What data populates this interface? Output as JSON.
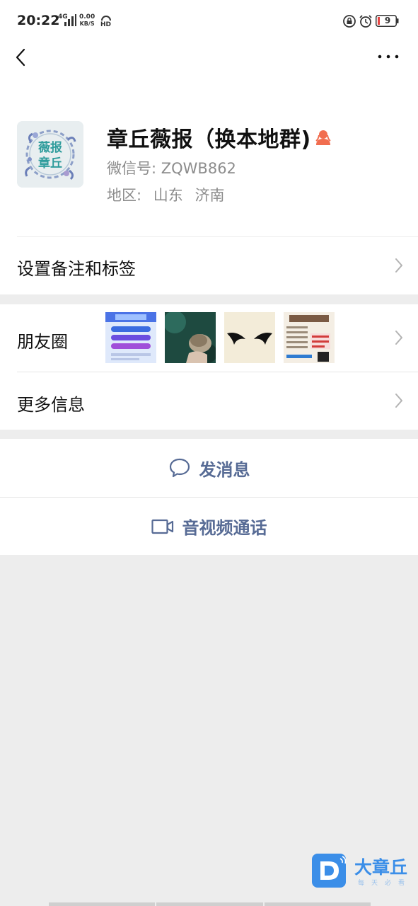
{
  "status_bar": {
    "time": "20:22",
    "network": "4G",
    "speed_value": "0.00",
    "speed_unit": "KB/S",
    "hd": "HD",
    "battery": "9"
  },
  "profile": {
    "name": "章丘薇报（换本地群)",
    "wechat_id": "微信号:  ZQWB862",
    "region_label": "地区:",
    "region_province": "山东",
    "region_city": "济南",
    "avatar_text_top": "薇报",
    "avatar_text_bottom": "章丘"
  },
  "rows": {
    "remark": "设置备注和标签",
    "moments": "朋友圈",
    "more_info": "更多信息"
  },
  "actions": {
    "message": "发消息",
    "call": "音视频通话"
  },
  "watermark": {
    "brand": "大章丘",
    "sub": "每天必看"
  },
  "colors": {
    "accent": "#576b95",
    "background": "#ededed",
    "gender_icon": "#f16d4f",
    "battery_low": "#e64340"
  }
}
